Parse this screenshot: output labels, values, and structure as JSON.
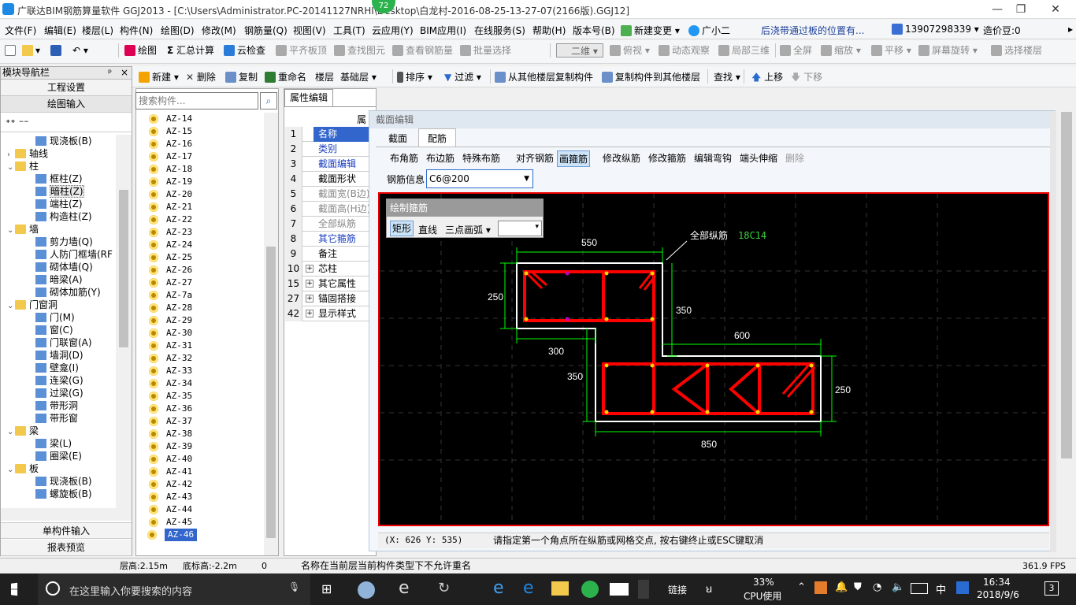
{
  "title_bar": {
    "text": "广联达BIM钢筋算量软件 GGJ2013 - [C:\\Users\\Administrator.PC-20141127NRHI\\Desktop\\白龙村-2016-08-25-13-27-07(2166版).GGJ12]",
    "badge": "72",
    "minimize": "—",
    "restore": "❐",
    "close": "✕"
  },
  "menu": {
    "items": [
      "文件(F)",
      "编辑(E)",
      "楼层(L)",
      "构件(N)",
      "绘图(D)",
      "修改(M)",
      "钢筋量(Q)",
      "视图(V)",
      "工具(T)",
      "云应用(Y)",
      "BIM应用(I)",
      "在线服务(S)",
      "帮助(H)",
      "版本号(B)"
    ],
    "new_change": "新建变更",
    "user_short": "广小二",
    "marquee": "后浇带通过板的位置有...",
    "phone": "13907298339",
    "beans": "造价豆:0"
  },
  "toolbar1": {
    "draw": "绘图",
    "sum": "汇总计算",
    "cloud_check": "云检查",
    "flat_top": "平齐板顶",
    "find_elem": "查找图元",
    "view_rebar": "查看钢筋量",
    "batch_select": "批量选择",
    "view_mode": "二维",
    "top_view": "俯视",
    "dynamic": "动态观察",
    "local3d": "局部三维",
    "fullscreen": "全屏",
    "zoom": "缩放",
    "pan": "平移",
    "rotate": "屏幕旋转",
    "select_floor": "选择楼层"
  },
  "toolbar2": {
    "new": "新建",
    "delete": "删除",
    "copy": "复制",
    "rename": "重命名",
    "floor_label": "楼层",
    "floor_value": "基础层",
    "sort": "排序",
    "filter": "过滤",
    "copy_from": "从其他楼层复制构件",
    "copy_to": "复制构件到其他楼层",
    "find": "查找",
    "up": "上移",
    "down": "下移"
  },
  "nav": {
    "title": "模块导航栏",
    "pin": "ᵖ",
    "close": "×",
    "project_settings": "工程设置",
    "drawing_input": "绘图输入",
    "single_input": "单构件输入",
    "report_preview": "报表预览",
    "tree": [
      {
        "label": "现浇板(B)",
        "indent": 2
      },
      {
        "label": "轴线",
        "indent": 1,
        "folder": true,
        "exp": "›"
      },
      {
        "label": "柱",
        "indent": 1,
        "folder": true,
        "exp": "⌄"
      },
      {
        "label": "框柱(Z)",
        "indent": 2
      },
      {
        "label": "暗柱(Z)",
        "indent": 2,
        "selected": true
      },
      {
        "label": "端柱(Z)",
        "indent": 2
      },
      {
        "label": "构造柱(Z)",
        "indent": 2
      },
      {
        "label": "墙",
        "indent": 1,
        "folder": true,
        "exp": "⌄"
      },
      {
        "label": "剪力墙(Q)",
        "indent": 2
      },
      {
        "label": "人防门框墙(RF",
        "indent": 2
      },
      {
        "label": "砌体墙(Q)",
        "indent": 2
      },
      {
        "label": "暗梁(A)",
        "indent": 2
      },
      {
        "label": "砌体加筋(Y)",
        "indent": 2
      },
      {
        "label": "门窗洞",
        "indent": 1,
        "folder": true,
        "exp": "⌄"
      },
      {
        "label": "门(M)",
        "indent": 2
      },
      {
        "label": "窗(C)",
        "indent": 2
      },
      {
        "label": "门联窗(A)",
        "indent": 2
      },
      {
        "label": "墙洞(D)",
        "indent": 2
      },
      {
        "label": "壁龛(I)",
        "indent": 2
      },
      {
        "label": "连梁(G)",
        "indent": 2
      },
      {
        "label": "过梁(G)",
        "indent": 2
      },
      {
        "label": "带形洞",
        "indent": 2
      },
      {
        "label": "带形窗",
        "indent": 2
      },
      {
        "label": "梁",
        "indent": 1,
        "folder": true,
        "exp": "⌄"
      },
      {
        "label": "梁(L)",
        "indent": 2
      },
      {
        "label": "圈梁(E)",
        "indent": 2
      },
      {
        "label": "板",
        "indent": 1,
        "folder": true,
        "exp": "⌄"
      },
      {
        "label": "现浇板(B)",
        "indent": 2
      },
      {
        "label": "螺旋板(B)",
        "indent": 2
      }
    ]
  },
  "list": {
    "search_placeholder": "搜索构件...",
    "items": [
      "AZ-14",
      "AZ-15",
      "AZ-16",
      "AZ-17",
      "AZ-18",
      "AZ-19",
      "AZ-20",
      "AZ-21",
      "AZ-22",
      "AZ-23",
      "AZ-24",
      "AZ-25",
      "AZ-26",
      "AZ-27",
      "AZ-7a",
      "AZ-28",
      "AZ-29",
      "AZ-30",
      "AZ-31",
      "AZ-32",
      "AZ-33",
      "AZ-34",
      "AZ-35",
      "AZ-36",
      "AZ-37",
      "AZ-38",
      "AZ-39",
      "AZ-40",
      "AZ-41",
      "AZ-42",
      "AZ-43",
      "AZ-44",
      "AZ-45",
      "AZ-46"
    ],
    "selected": "AZ-46"
  },
  "props": {
    "tab": "属性编辑",
    "header": "属",
    "rows": [
      {
        "n": "1",
        "label": "名称",
        "style": "sel"
      },
      {
        "n": "2",
        "label": "类别",
        "style": "blue"
      },
      {
        "n": "3",
        "label": "截面编辑",
        "style": "blue"
      },
      {
        "n": "4",
        "label": "截面形状",
        "style": ""
      },
      {
        "n": "5",
        "label": "截面宽(B边)",
        "style": "gray"
      },
      {
        "n": "6",
        "label": "截面高(H边)",
        "style": "gray"
      },
      {
        "n": "7",
        "label": "全部纵筋",
        "style": "gray"
      },
      {
        "n": "8",
        "label": "其它箍筋",
        "style": "blue"
      },
      {
        "n": "9",
        "label": "备注",
        "style": ""
      },
      {
        "n": "10",
        "label": "芯柱",
        "style": "exp"
      },
      {
        "n": "15",
        "label": "其它属性",
        "style": "exp"
      },
      {
        "n": "27",
        "label": "锚固搭接",
        "style": "exp"
      },
      {
        "n": "42",
        "label": "显示样式",
        "style": "exp"
      }
    ]
  },
  "dialog": {
    "title": "截面编辑",
    "tabs": [
      "截面",
      "配筋"
    ],
    "active_tab": "配筋",
    "tools": [
      "布角筋",
      "布边筋",
      "特殊布筋",
      "对齐钢筋",
      "画箍筋",
      "修改纵筋",
      "修改箍筋",
      "编辑弯钩",
      "端头伸缩",
      "删除"
    ],
    "active_tool": "画箍筋",
    "rebar_info_label": "钢筋信息",
    "rebar_info_value": "C6@200",
    "draw_stirrup": {
      "title": "绘制箍筋",
      "rect": "矩形",
      "line": "直线",
      "arc": "三点画弧",
      "dropdown": ""
    },
    "dims": {
      "d550": "550",
      "d250a": "250",
      "d350a": "350",
      "d300": "300",
      "d600": "600",
      "d350b": "350",
      "d250b": "250",
      "d850": "850"
    },
    "annotation_label": "全部纵筋",
    "annotation_value": "18C14",
    "coords": "(X: 626 Y: 535)",
    "hint": "请指定第一个角点所在纵筋或网格交点, 按右键终止或ESC键取消"
  },
  "status": {
    "floor_height": "层高:2.15m",
    "bottom_height": "底标高:-2.2m",
    "zero": "0",
    "message": "名称在当前层当前构件类型下不允许重名",
    "fps": "361.9 FPS"
  },
  "taskbar": {
    "search": "在这里输入你要搜索的内容",
    "link": "链接",
    "cpu_percent": "33%",
    "cpu_label": "CPU使用",
    "ime": "中",
    "time": "16:34",
    "date": "2018/9/6",
    "notif": "3"
  },
  "colors": {
    "rebar": "#ff0000",
    "dim_line": "#00ff00",
    "section_outline": "#ffffff",
    "accent_blue": "#3366cc"
  }
}
